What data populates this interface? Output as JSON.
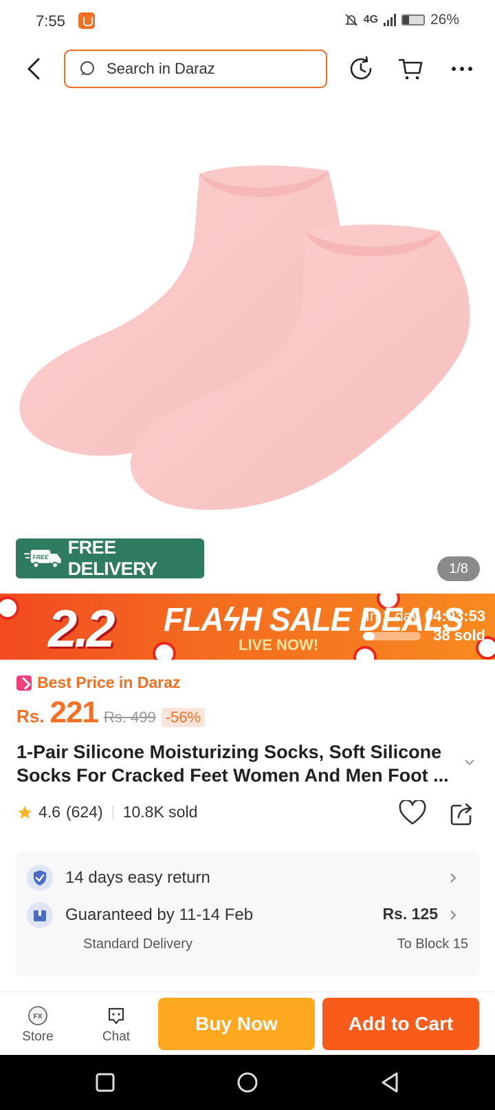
{
  "status_bar": {
    "time": "7:55",
    "network": "4G",
    "battery": "26%"
  },
  "header": {
    "search_placeholder": "Search in Daraz",
    "accent_color": "#f36f21"
  },
  "product_image": {
    "badge_label": "FREE DELIVERY",
    "badge_truck_text": "FREE",
    "counter": "1/8"
  },
  "flash_sale": {
    "campaign_logo": "2.2",
    "title": "FLAϟH SALE DEALS",
    "subtitle": "LIVE NOW!",
    "countdown_label": "In 1 day",
    "countdown_time": "04:03:53",
    "progress": 0.2,
    "sold": "38 sold"
  },
  "price": {
    "best_price_label": "Best Price in Daraz",
    "currency": "Rs.",
    "current": "221",
    "original": "Rs. 499",
    "discount": "-56%"
  },
  "product": {
    "title": "1-Pair Silicone Moisturizing Socks, Soft Silicone Socks For Cracked Feet Women And Men Foot ...",
    "rating": "4.6",
    "review_count": "(624)",
    "sold": "10.8K sold"
  },
  "services": {
    "return_label": "14 days easy return",
    "delivery_label": "Guaranteed by 11-14 Feb",
    "delivery_type": "Standard Delivery",
    "delivery_fee": "Rs. 125",
    "delivery_to": "To Block 15"
  },
  "bottom_bar": {
    "store_label": "Store",
    "chat_label": "Chat",
    "buy_now_label": "Buy Now",
    "add_to_cart_label": "Add to Cart",
    "buy_now_color": "#fea820",
    "add_to_cart_color": "#f85b1a"
  }
}
